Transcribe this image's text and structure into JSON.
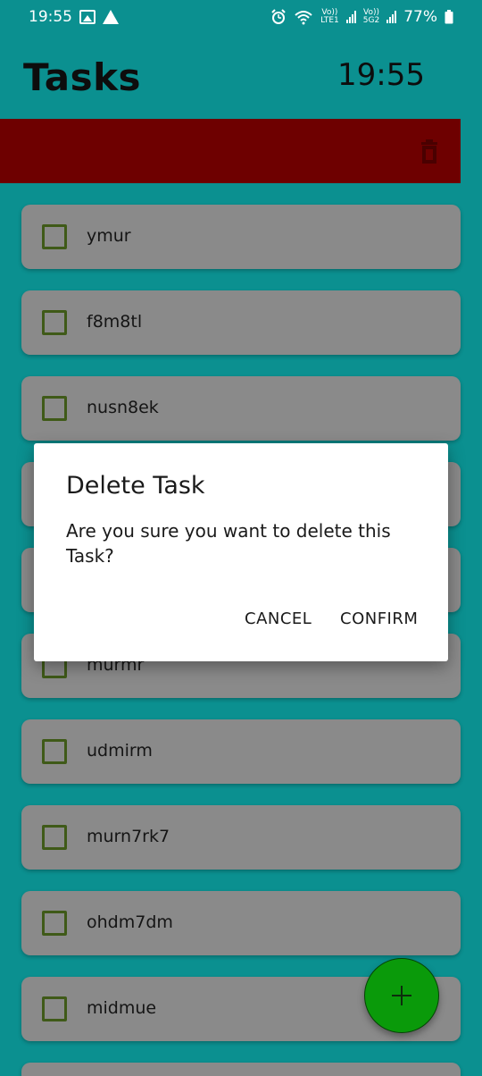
{
  "status_bar": {
    "time": "19:55",
    "volte1": "Vo))",
    "lte1": "LTE1",
    "volte2": "Vo))",
    "lte2": "5G2",
    "battery": "77%",
    "icons": [
      "gallery-icon",
      "warning-icon",
      "alarm-icon",
      "wifi-icon",
      "signal-icon",
      "battery-icon"
    ]
  },
  "header": {
    "title": "Tasks",
    "clock": "19:55"
  },
  "action_bar": {
    "color": "#6e0000",
    "delete_icon": "trash-icon"
  },
  "tasks": [
    {
      "label": "ymur",
      "checked": false
    },
    {
      "label": "f8m8tl",
      "checked": false
    },
    {
      "label": "nusn8ek",
      "checked": false
    },
    {
      "label": "",
      "checked": false
    },
    {
      "label": "",
      "checked": false
    },
    {
      "label": "murmr",
      "checked": false
    },
    {
      "label": "udmirm",
      "checked": false
    },
    {
      "label": "murn7rk7",
      "checked": false
    },
    {
      "label": "ohdm7dm",
      "checked": false
    },
    {
      "label": "midmue",
      "checked": false
    },
    {
      "label": "",
      "checked": false
    }
  ],
  "dialog": {
    "title": "Delete Task",
    "message": "Are you sure you want to delete this Task?",
    "cancel_label": "CANCEL",
    "confirm_label": "CONFIRM"
  },
  "fab": {
    "icon": "plus-icon",
    "color": "#0a9a0a"
  },
  "colors": {
    "background": "#0b9090",
    "task_card": "#8a8a8a",
    "checkbox_border": "#3f5a18"
  }
}
